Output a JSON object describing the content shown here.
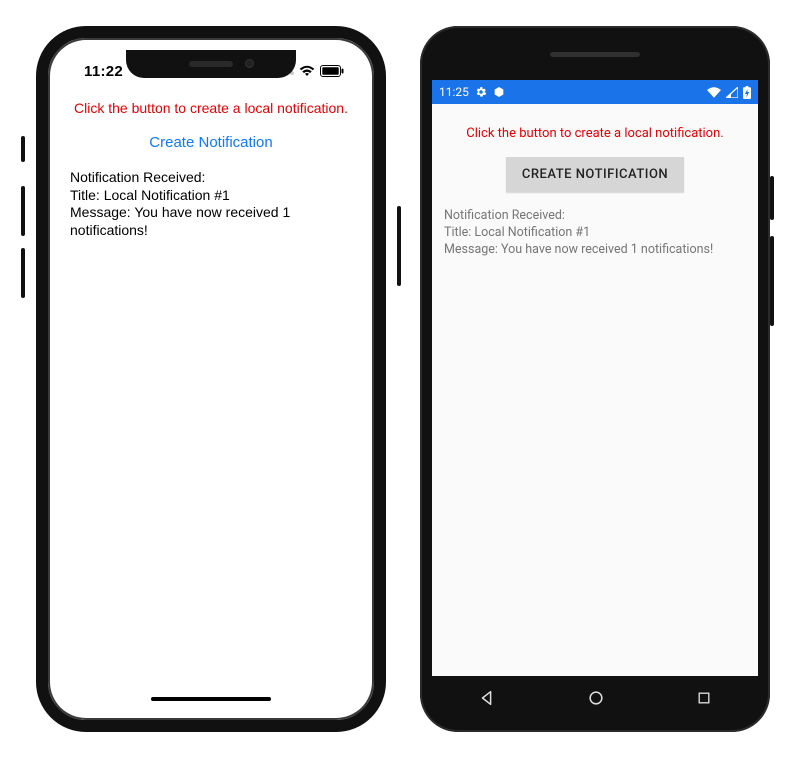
{
  "ios": {
    "status": {
      "time": "11:22"
    },
    "instruction": "Click the button to create a local notification.",
    "button_label": "Create Notification",
    "output": {
      "header": "Notification Received:",
      "title_line": "Title: Local Notification #1",
      "message_line": "Message: You have now received 1 notifications!"
    }
  },
  "android": {
    "status": {
      "time": "11:25"
    },
    "instruction": "Click the button to create a local notification.",
    "button_label": "CREATE NOTIFICATION",
    "output": {
      "header": "Notification Received:",
      "title_line": "Title: Local Notification #1",
      "message_line": "Message: You have now received 1 notifications!"
    }
  }
}
